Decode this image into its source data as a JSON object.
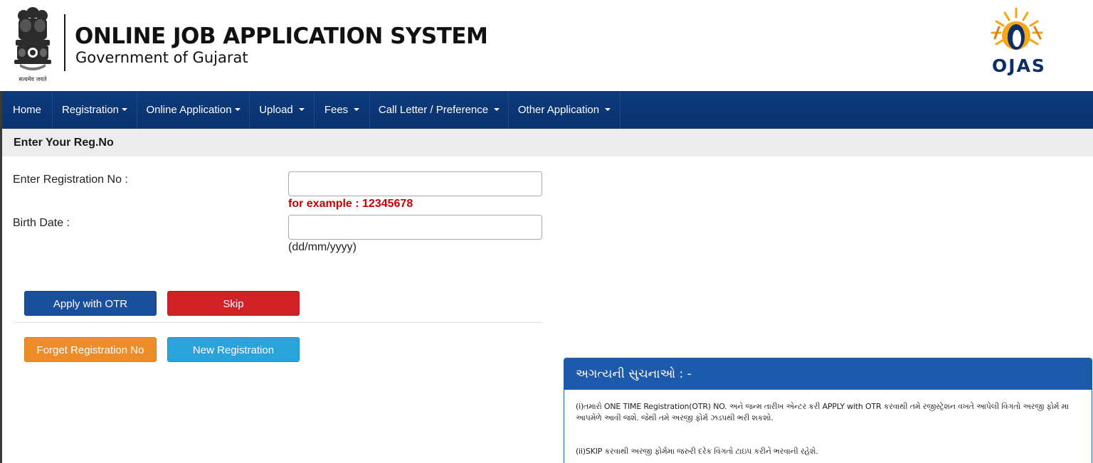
{
  "header": {
    "emblem_caption": "सत्यमेव जयते",
    "title": "ONLINE JOB APPLICATION SYSTEM",
    "subtitle": "Government of Gujarat",
    "logo_text": "OJAS"
  },
  "nav": {
    "items": [
      {
        "label": "Home",
        "has_caret": false
      },
      {
        "label": "Registration",
        "has_caret": true
      },
      {
        "label": "Online Application",
        "has_caret": true
      },
      {
        "label": "Upload",
        "has_caret": true
      },
      {
        "label": "Fees",
        "has_caret": true
      },
      {
        "label": "Call Letter / Preference",
        "has_caret": true
      },
      {
        "label": "Other Application",
        "has_caret": true
      }
    ]
  },
  "section": {
    "title": "Enter Your Reg.No"
  },
  "form": {
    "reg_label": "Enter Registration No :",
    "reg_value": "",
    "reg_hint": "for example : 12345678",
    "dob_label": "Birth Date :",
    "dob_value": "",
    "dob_hint": "(dd/mm/yyyy)"
  },
  "buttons": {
    "apply_otr": "Apply with OTR",
    "skip": "Skip",
    "forget_reg": "Forget Registration No",
    "new_reg": "New Registration"
  },
  "notice": {
    "title": "અગત્યની સુચનાઓ : -",
    "items": [
      "(i)તમારો ONE TIME Registration(OTR) NO. અને જન્મ તારીખ એન્ટર કરી APPLY with OTR કરવાથી તમે રજીસ્ટ્રેશન વખતે આપેલી વિગતો અરજી ફોર્મ મા આપમેળે આવી જશે. જેથી તમે અરજી ફોર્મ ઝડપથી ભરી શકશો.",
      "(ii)SKIP કરવાથી અરજી ફોર્મમા જરુરી દરેક વિગતો ટાઇપ કરીને ભરવાની રહેશે."
    ]
  },
  "colors": {
    "nav_bg": "#0d3b7c",
    "notice_head_bg": "#1d5aab",
    "hint_red": "#c60000",
    "btn_blue": "#1a4f9c",
    "btn_red": "#d02127",
    "btn_orange": "#ec8d2a",
    "btn_cyan": "#2aa3da"
  }
}
